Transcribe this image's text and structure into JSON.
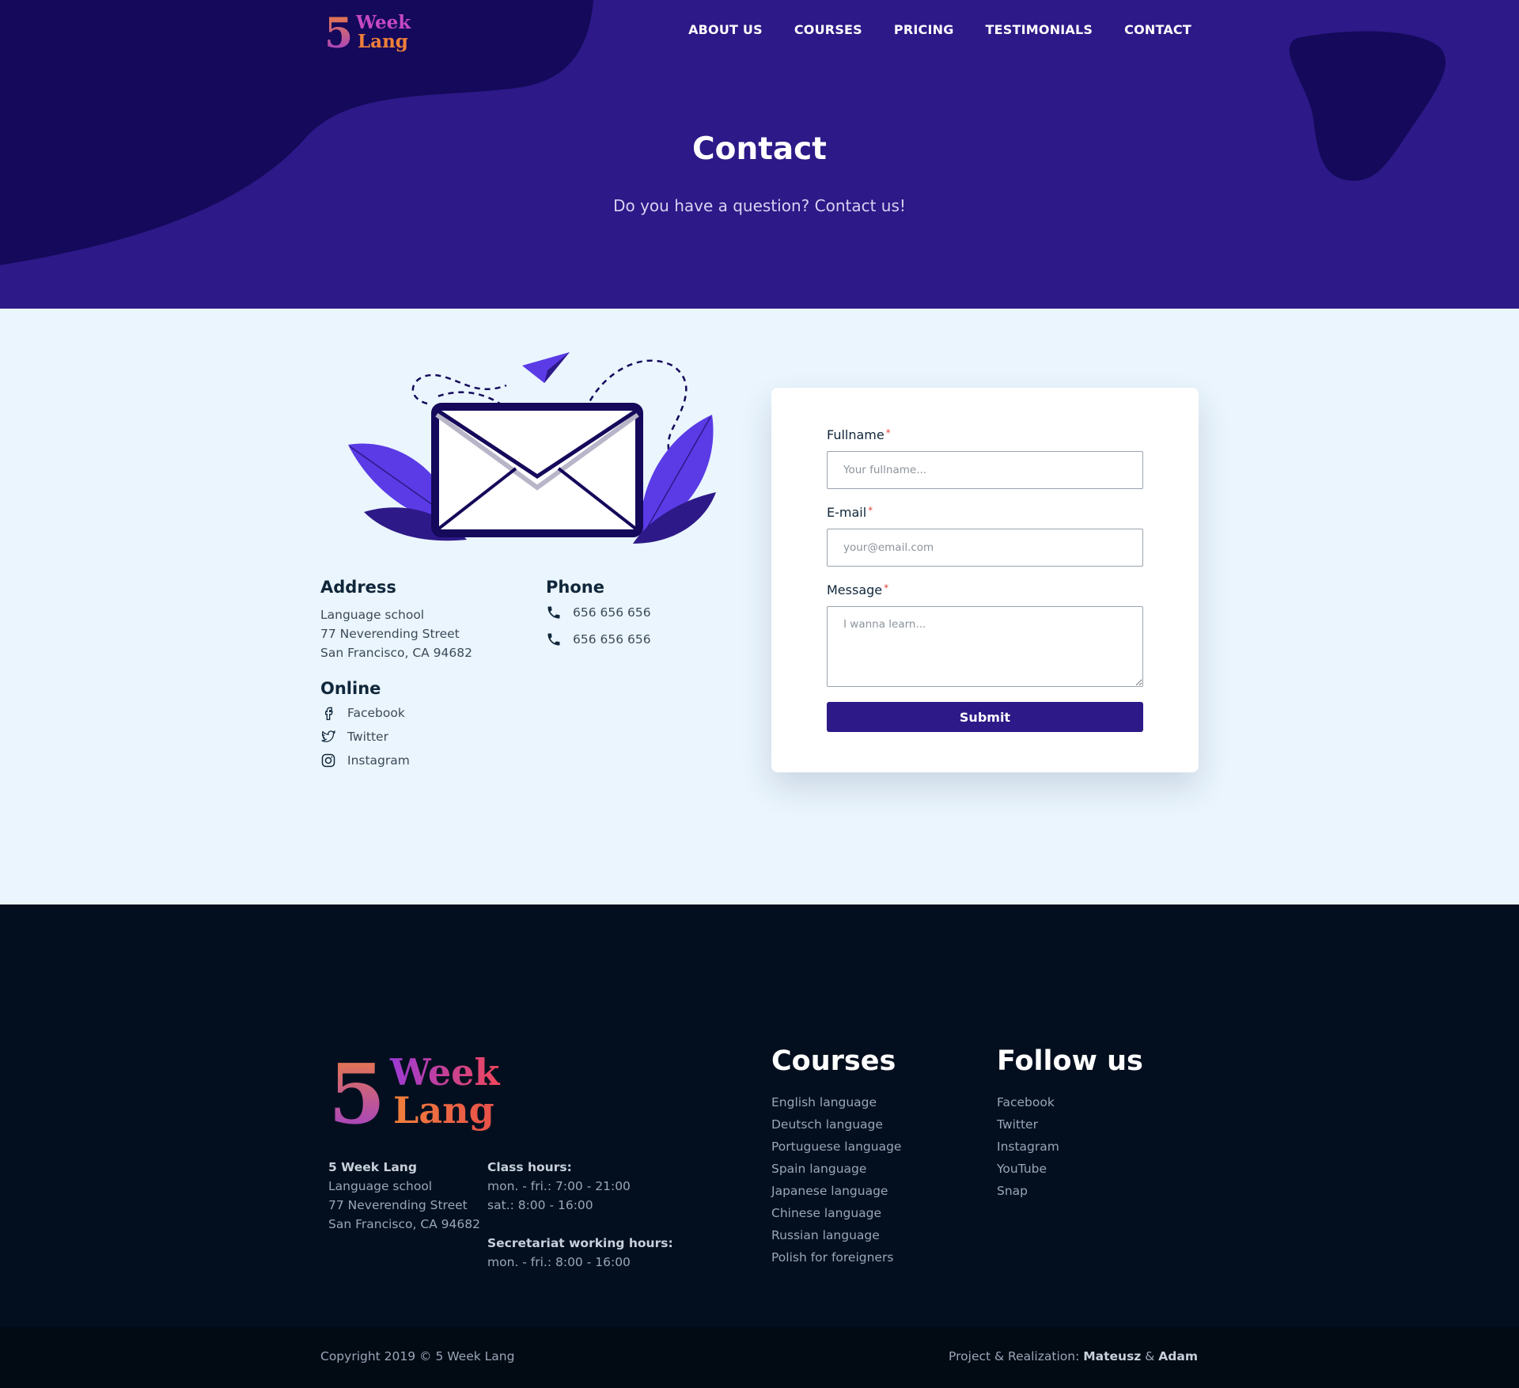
{
  "brand": {
    "line1": "Week",
    "line2": "Lang",
    "digit": "5"
  },
  "nav": {
    "items": [
      "ABOUT US",
      "COURSES",
      "PRICING",
      "TESTIMONIALS",
      "CONTACT"
    ]
  },
  "hero": {
    "title": "Contact",
    "subtitle": "Do you have a question? Contact us!"
  },
  "contact_info": {
    "address_heading": "Address",
    "address_lines": [
      "Language school",
      "77 Neverending Street",
      "San Francisco, CA 94682"
    ],
    "phone_heading": "Phone",
    "phones": [
      "656 656 656",
      "656 656 656"
    ],
    "online_heading": "Online",
    "online_links": [
      {
        "label": "Facebook",
        "icon": "facebook-icon"
      },
      {
        "label": "Twitter",
        "icon": "twitter-icon"
      },
      {
        "label": "Instagram",
        "icon": "instagram-icon"
      }
    ]
  },
  "form": {
    "fullname_label": "Fullname",
    "fullname_placeholder": "Your fullname...",
    "email_label": "E-mail",
    "email_placeholder": "your@email.com",
    "message_label": "Message",
    "message_placeholder": "I wanna learn...",
    "required_mark": "*",
    "submit_label": "Submit"
  },
  "footer": {
    "company_name": "5 Week Lang",
    "company_lines": [
      "Language school",
      "77 Neverending Street",
      "San Francisco, CA 94682"
    ],
    "class_hours_heading": "Class hours:",
    "class_hours_lines": [
      "mon. - fri.: 7:00 - 21:00",
      "sat.: 8:00 - 16:00"
    ],
    "secretariat_heading": "Secretariat working hours:",
    "secretariat_lines": [
      "mon. - fri.: 8:00 - 16:00"
    ],
    "courses_heading": "Courses",
    "courses": [
      "English language",
      "Deutsch language",
      "Portuguese language",
      "Spain language",
      "Japanese language",
      "Chinese language",
      "Russian language",
      "Polish for foreigners"
    ],
    "follow_heading": "Follow us",
    "follow_links": [
      "Facebook",
      "Twitter",
      "Instagram",
      "YouTube",
      "Snap"
    ]
  },
  "bottom_bar": {
    "copyright": "Copyright 2019 © 5 Week Lang",
    "credits_prefix": "Project & Realization:",
    "author1": "Mateusz",
    "amp": "&",
    "author2": "Adam"
  },
  "colors": {
    "hero_bg": "#2d1987",
    "hero_blob": "#14095a",
    "section_bg": "#eaf5fd",
    "footer_bg": "#030f1f",
    "accent_orange": "#f0803a",
    "accent_purple": "#9a3ad6",
    "submit_bg": "#2d1987"
  }
}
